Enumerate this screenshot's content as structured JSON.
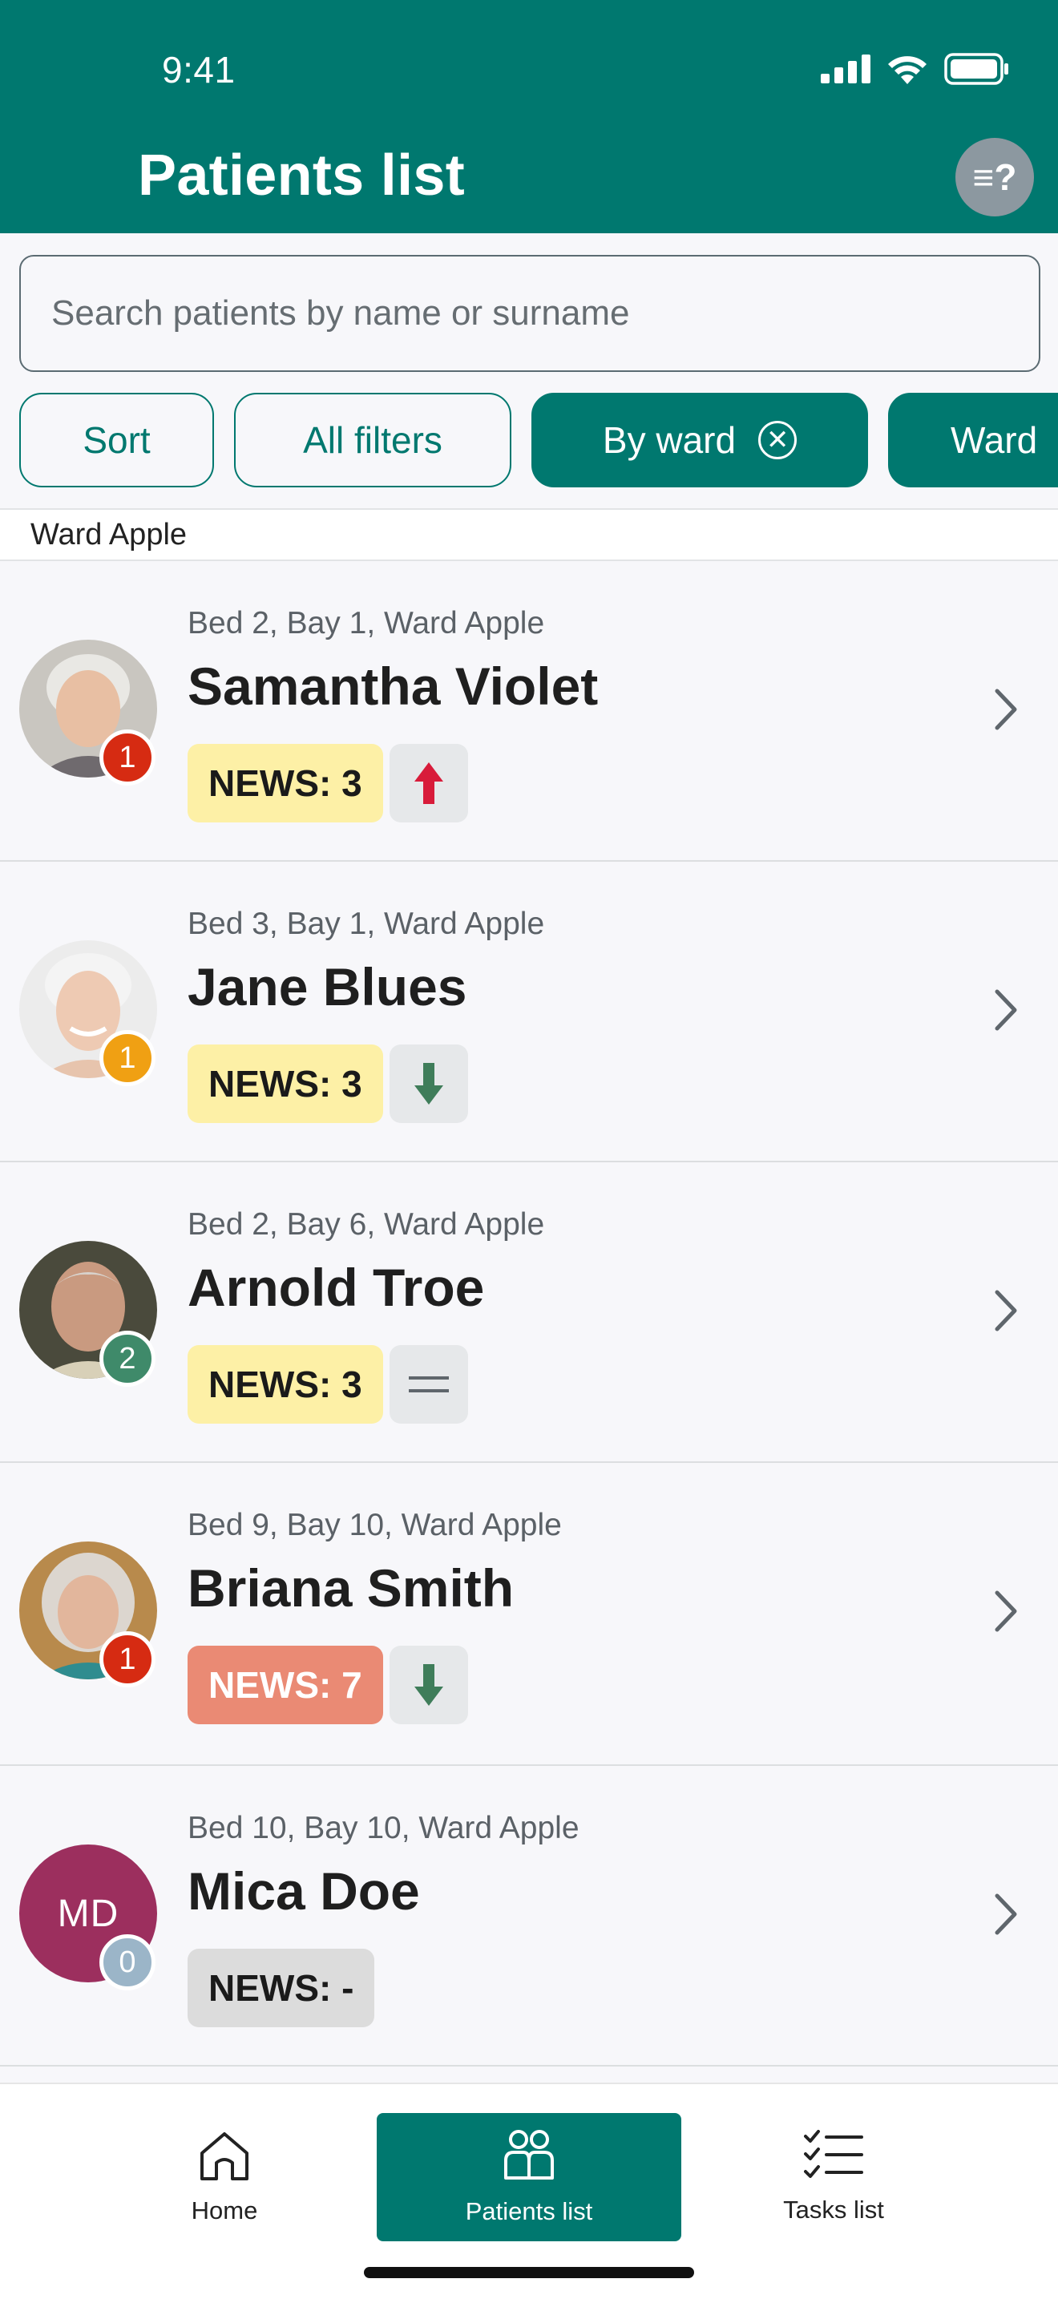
{
  "status_bar": {
    "time": "9:41"
  },
  "header": {
    "title": "Patients list",
    "help_label": "≡?"
  },
  "search": {
    "placeholder": "Search patients by name or surname",
    "value": ""
  },
  "filters": [
    {
      "label": "Sort",
      "active": false
    },
    {
      "label": "All filters",
      "active": false
    },
    {
      "label": "By ward",
      "active": true,
      "removable": true
    },
    {
      "label": "Ward",
      "active": true
    }
  ],
  "section": {
    "label": "Ward Apple"
  },
  "patients": [
    {
      "location": "Bed 2, Bay 1, Ward Apple",
      "name": "Samantha Violet",
      "news": "NEWS: 3",
      "news_level": "medium",
      "trend": "up",
      "badge": "1",
      "badge_color": "#d62b12",
      "avatar": "photo"
    },
    {
      "location": "Bed 3, Bay 1, Ward Apple",
      "name": "Jane Blues",
      "news": "NEWS: 3",
      "news_level": "medium",
      "trend": "down",
      "badge": "1",
      "badge_color": "#f0a013",
      "avatar": "photo"
    },
    {
      "location": "Bed 2, Bay 6, Ward Apple",
      "name": "Arnold Troe",
      "news": "NEWS: 3",
      "news_level": "medium",
      "trend": "steady",
      "badge": "2",
      "badge_color": "#3f8a6a",
      "avatar": "photo"
    },
    {
      "location": "Bed 9, Bay 10, Ward Apple",
      "name": "Briana Smith",
      "news": "NEWS: 7",
      "news_level": "high",
      "trend": "down",
      "badge": "1",
      "badge_color": "#d62b12",
      "avatar": "photo"
    },
    {
      "location": "Bed 10, Bay 10, Ward Apple",
      "name": "Mica Doe",
      "news": "NEWS: -",
      "news_level": "none",
      "trend": "",
      "badge": "0",
      "badge_color": "#9bb5c8",
      "avatar": "MD"
    }
  ],
  "nav": [
    {
      "label": "Home",
      "icon": "home-icon",
      "active": false
    },
    {
      "label": "Patients list",
      "icon": "patients-icon",
      "active": true
    },
    {
      "label": "Tasks list",
      "icon": "tasks-icon",
      "active": false
    }
  ],
  "colors": {
    "primary": "#00786f",
    "news_medium": "#fdf0a6",
    "news_high": "#ea8a74",
    "news_none": "#dcdcdc",
    "trend_up": "#d81b3a",
    "trend_down": "#3f7d5a"
  }
}
